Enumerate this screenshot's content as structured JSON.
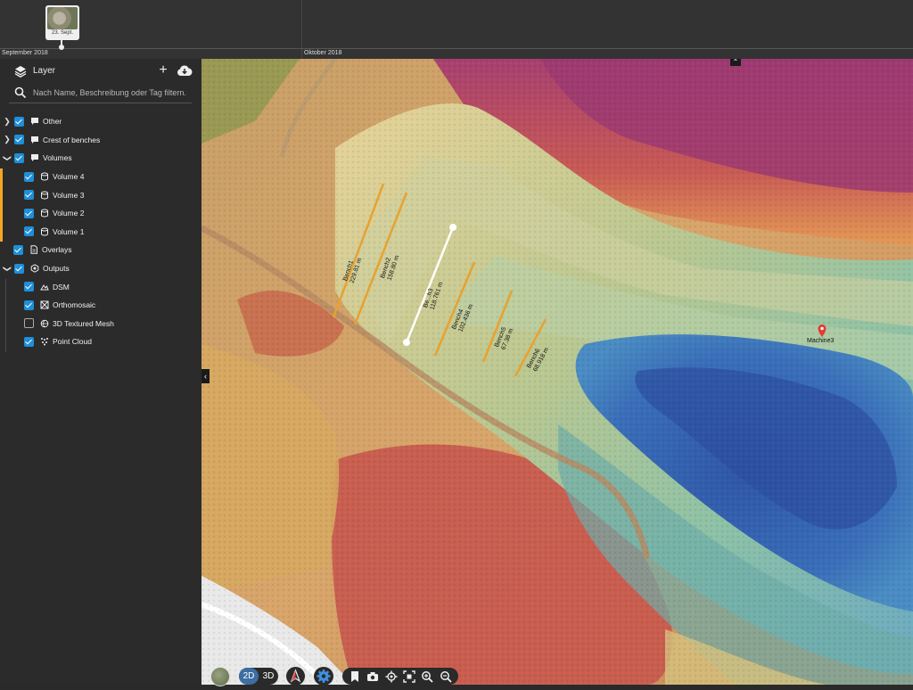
{
  "timeline": {
    "thumb_date": "23. Sept.",
    "months": [
      "September 2018",
      "Oktober 2018"
    ]
  },
  "sidebar": {
    "title": "Layer",
    "search_placeholder": "Nach Name, Beschreibung oder Tag filtern.",
    "tree": [
      {
        "label": "Other",
        "checked": true,
        "expanded": false,
        "icon": "comment-icon"
      },
      {
        "label": "Crest of benches",
        "checked": true,
        "expanded": false,
        "icon": "comment-icon"
      },
      {
        "label": "Volumes",
        "checked": true,
        "expanded": true,
        "icon": "comment-icon"
      },
      {
        "label": "Volume 4",
        "checked": true,
        "icon": "cylinder-icon"
      },
      {
        "label": "Volume 3",
        "checked": true,
        "icon": "cylinder-icon"
      },
      {
        "label": "Volume 2",
        "checked": true,
        "icon": "cylinder-icon"
      },
      {
        "label": "Volume 1",
        "checked": true,
        "icon": "cylinder-icon"
      },
      {
        "label": "Overlays",
        "checked": true,
        "icon": "document-icon"
      },
      {
        "label": "Outputs",
        "checked": true,
        "expanded": true,
        "icon": "hexagon-icon"
      },
      {
        "label": "DSM",
        "checked": true,
        "icon": "dsm-icon"
      },
      {
        "label": "Orthomosaic",
        "checked": true,
        "icon": "orthomosaic-icon"
      },
      {
        "label": "3D Textured Mesh",
        "checked": false,
        "icon": "mesh-icon"
      },
      {
        "label": "Point Cloud",
        "checked": true,
        "icon": "point-cloud-icon"
      }
    ]
  },
  "map": {
    "benches": [
      {
        "name": "Bench1",
        "length": "229.81 m"
      },
      {
        "name": "Bench2",
        "length": "158.80 m"
      },
      {
        "name": "Be...h3",
        "length": "118.761 m"
      },
      {
        "name": "Bench4",
        "length": "102.436 m"
      },
      {
        "name": "Bench5",
        "length": "67.38 m"
      },
      {
        "name": "Bench6",
        "length": "68.918 m"
      }
    ],
    "marker_label": "Machine3"
  },
  "toolbar": {
    "mode_2d": "2D",
    "mode_3d": "3D",
    "active_mode": "2D"
  },
  "colors": {
    "accent_blue": "#1e8fd8",
    "mode_active": "#3d6ea3",
    "volume_highlight": "#f5a623",
    "marker_red": "#e53935"
  }
}
